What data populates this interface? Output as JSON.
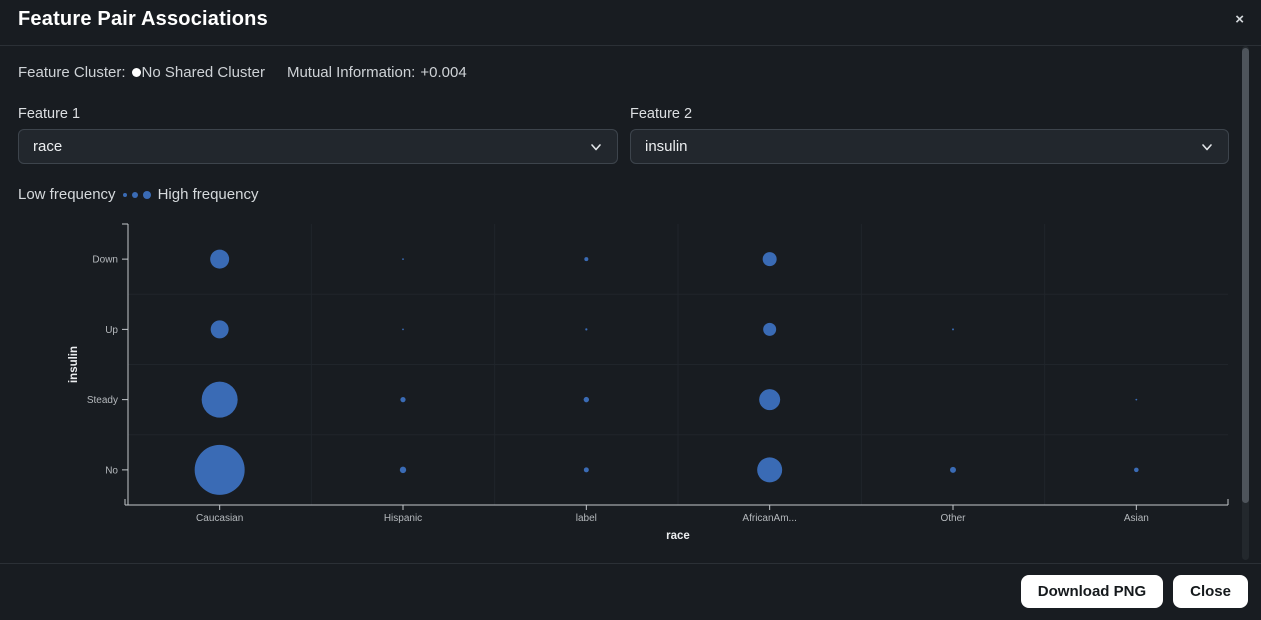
{
  "modal": {
    "title": "Feature Pair Associations",
    "close_icon": "×"
  },
  "info": {
    "cluster_label": "Feature Cluster:",
    "cluster_value": "No Shared Cluster",
    "mi_label": "Mutual Information:",
    "mi_value": "+0.004"
  },
  "selectors": {
    "feature1": {
      "label": "Feature 1",
      "value": "race"
    },
    "feature2": {
      "label": "Feature 2",
      "value": "insulin"
    }
  },
  "legend": {
    "low_label": "Low frequency",
    "high_label": "High frequency"
  },
  "footer": {
    "download_label": "Download PNG",
    "close_label": "Close"
  },
  "colors": {
    "bubble": "#3a6bb5",
    "axis": "#c3c7cb",
    "tick_text": "#b5b9bd",
    "grid": "#20252b",
    "title_text": "#eceef0"
  },
  "chart_data": {
    "type": "scatter",
    "subtype": "bubble-matrix",
    "xlabel": "race",
    "ylabel": "insulin",
    "x_categories": [
      "Caucasian",
      "Hispanic",
      "label",
      "AfricanAm...",
      "Other",
      "Asian"
    ],
    "y_categories": [
      "Down",
      "Up",
      "Steady",
      "No"
    ],
    "size_encoding": "frequency (bubble radius px, larger = higher frequency)",
    "bubbles": [
      {
        "x": "Caucasian",
        "y": "Down",
        "r": 9.5
      },
      {
        "x": "Caucasian",
        "y": "Up",
        "r": 9
      },
      {
        "x": "Caucasian",
        "y": "Steady",
        "r": 18
      },
      {
        "x": "Caucasian",
        "y": "No",
        "r": 25
      },
      {
        "x": "Hispanic",
        "y": "Down",
        "r": 0.9
      },
      {
        "x": "Hispanic",
        "y": "Up",
        "r": 0.9
      },
      {
        "x": "Hispanic",
        "y": "Steady",
        "r": 2.6
      },
      {
        "x": "Hispanic",
        "y": "No",
        "r": 3.2
      },
      {
        "x": "label",
        "y": "Down",
        "r": 2
      },
      {
        "x": "label",
        "y": "Up",
        "r": 1.1
      },
      {
        "x": "label",
        "y": "Steady",
        "r": 2.7
      },
      {
        "x": "label",
        "y": "No",
        "r": 2.5
      },
      {
        "x": "AfricanAm...",
        "y": "Down",
        "r": 7
      },
      {
        "x": "AfricanAm...",
        "y": "Up",
        "r": 6.5
      },
      {
        "x": "AfricanAm...",
        "y": "Steady",
        "r": 10.5
      },
      {
        "x": "AfricanAm...",
        "y": "No",
        "r": 12.5
      },
      {
        "x": "Other",
        "y": "Up",
        "r": 1
      },
      {
        "x": "Other",
        "y": "No",
        "r": 3
      },
      {
        "x": "Asian",
        "y": "Steady",
        "r": 0.9
      },
      {
        "x": "Asian",
        "y": "No",
        "r": 2.3
      }
    ]
  }
}
